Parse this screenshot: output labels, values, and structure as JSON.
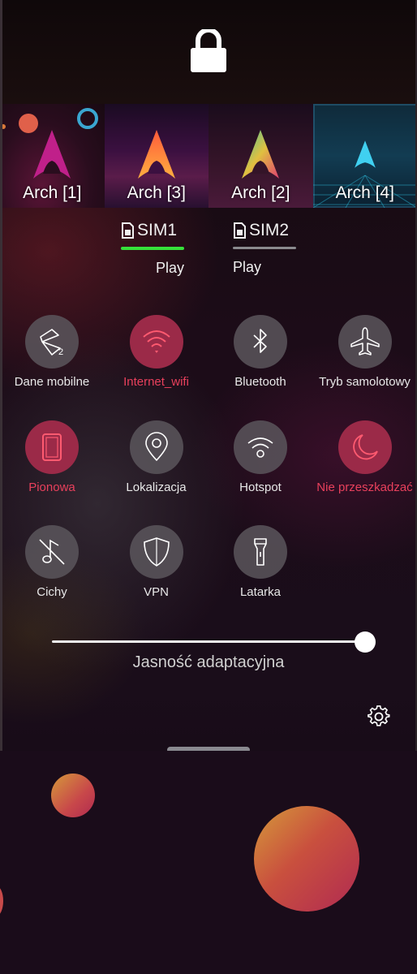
{
  "wallpapers": [
    {
      "label": "Arch [1]"
    },
    {
      "label": "Arch [3]"
    },
    {
      "label": "Arch [2]"
    },
    {
      "label": "Arch [4]"
    }
  ],
  "sims": [
    {
      "name": "SIM1",
      "operator": "Play",
      "selected": true
    },
    {
      "name": "SIM2",
      "operator": "Play",
      "selected": false
    }
  ],
  "toggles": {
    "mobile_data": {
      "label": "Dane mobilne",
      "icon": "mobile-data-icon",
      "active": false
    },
    "internet_wifi": {
      "label": "Internet_wifi",
      "icon": "wifi-icon",
      "active": true
    },
    "bluetooth": {
      "label": "Bluetooth",
      "icon": "bluetooth-icon",
      "active": false
    },
    "airplane": {
      "label": "Tryb samolotowy",
      "icon": "airplane-icon",
      "active": false
    },
    "orientation": {
      "label": "Pionowa",
      "icon": "portrait-orientation-icon",
      "active": true
    },
    "location": {
      "label": "Lokalizacja",
      "icon": "location-pin-icon",
      "active": false
    },
    "hotspot": {
      "label": "Hotspot",
      "icon": "hotspot-icon",
      "active": false
    },
    "dnd": {
      "label": "Nie przeszkadzać",
      "icon": "moon-icon",
      "active": true
    },
    "silent": {
      "label": "Cichy",
      "icon": "muted-note-icon",
      "active": false
    },
    "vpn": {
      "label": "VPN",
      "icon": "shield-icon",
      "active": false
    },
    "flashlight": {
      "label": "Latarka",
      "icon": "flashlight-icon",
      "active": false
    }
  },
  "brightness": {
    "label": "Jasność adaptacyjna",
    "level": 0.97
  },
  "colors": {
    "accent": "#e8405c",
    "active_toggle": "#9b2a48",
    "sim_selected": "#36e13a"
  }
}
